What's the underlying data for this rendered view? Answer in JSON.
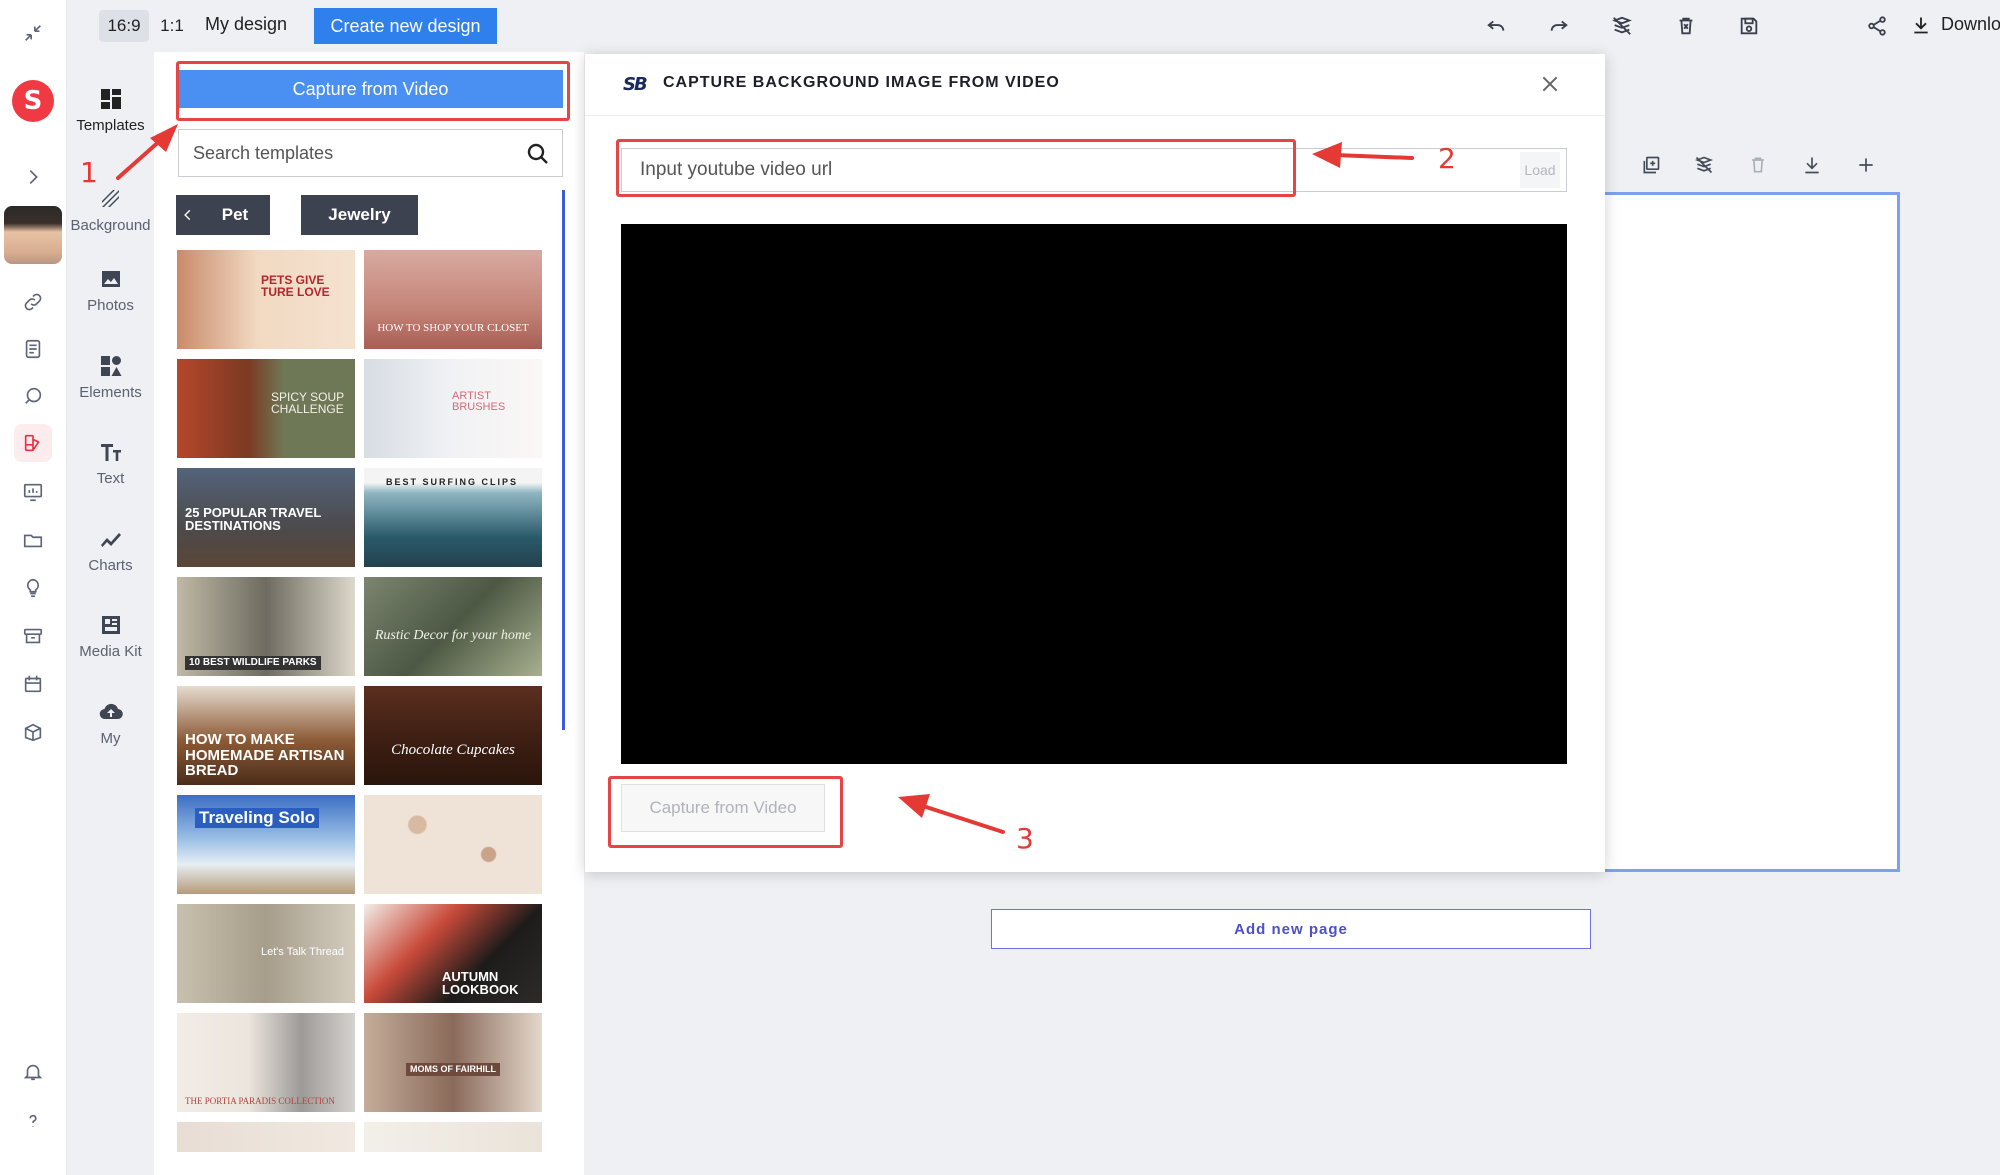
{
  "app": {
    "logo_letter": "S",
    "brand_color": "#ef3a44",
    "accent_color": "#2f80ed"
  },
  "topbar": {
    "ratios": [
      "16:9",
      "1:1"
    ],
    "active_ratio": "16:9",
    "my_design": "My design",
    "create_new": "Create new design",
    "download": "Download",
    "icons": [
      "undo-icon",
      "redo-icon",
      "clear-format-icon",
      "delete-icon",
      "save-icon",
      "share-icon",
      "download-icon"
    ]
  },
  "rail": {
    "icons": [
      "collapse-icon",
      "logo",
      "expand-icon",
      "avatar",
      "link-icon",
      "document-icon",
      "search-chat-icon",
      "design-icon",
      "presentation-icon",
      "folder-icon",
      "bulb-icon",
      "archive-icon",
      "calendar-icon",
      "box-icon",
      "bell-icon",
      "help-icon"
    ]
  },
  "tools": [
    {
      "label": "Templates",
      "icon": "templates-icon"
    },
    {
      "label": "Background",
      "icon": "background-icon"
    },
    {
      "label": "Photos",
      "icon": "photos-icon"
    },
    {
      "label": "Elements",
      "icon": "elements-icon"
    },
    {
      "label": "Text",
      "icon": "text-icon"
    },
    {
      "label": "Charts",
      "icon": "charts-icon"
    },
    {
      "label": "Media Kit",
      "icon": "media-kit-icon"
    },
    {
      "label": "My",
      "icon": "cloud-upload-icon"
    }
  ],
  "panel": {
    "capture_button": "Capture from Video",
    "search_placeholder": "Search templates",
    "chips": [
      "Pet",
      "Jewelry"
    ],
    "templates": [
      {
        "caption": "PETS GIVE TURE LOVE"
      },
      {
        "caption": "HOW TO SHOP YOUR CLOSET"
      },
      {
        "caption": "SPICY SOUP CHALLENGE"
      },
      {
        "caption": "ARTIST BRUSHES"
      },
      {
        "caption": "25 POPULAR TRAVEL DESTINATIONS"
      },
      {
        "caption": "BEST SURFING CLIPS"
      },
      {
        "caption": "10 BEST WILDLIFE PARKS"
      },
      {
        "caption": "Rustic Decor for your home"
      },
      {
        "caption": "HOW TO MAKE HOMEMADE ARTISAN BREAD"
      },
      {
        "caption": "Chocolate Cupcakes"
      },
      {
        "caption": "Traveling Solo"
      },
      {
        "caption": ""
      },
      {
        "caption": "Let's Talk Thread"
      },
      {
        "caption": "AUTUMN LOOKBOOK"
      },
      {
        "caption": "THE PORTIA PARADIS COLLECTION"
      },
      {
        "caption": "MOMS OF FAIRHILL"
      }
    ]
  },
  "modal": {
    "title": "CAPTURE BACKGROUND IMAGE FROM VIDEO",
    "logo_text": "SB",
    "url_placeholder": "Input youtube video url",
    "load_button": "Load",
    "capture_button": "Capture from Video"
  },
  "stage": {
    "add_page": "Add new page"
  },
  "annotations": [
    "1",
    "2",
    "3"
  ]
}
